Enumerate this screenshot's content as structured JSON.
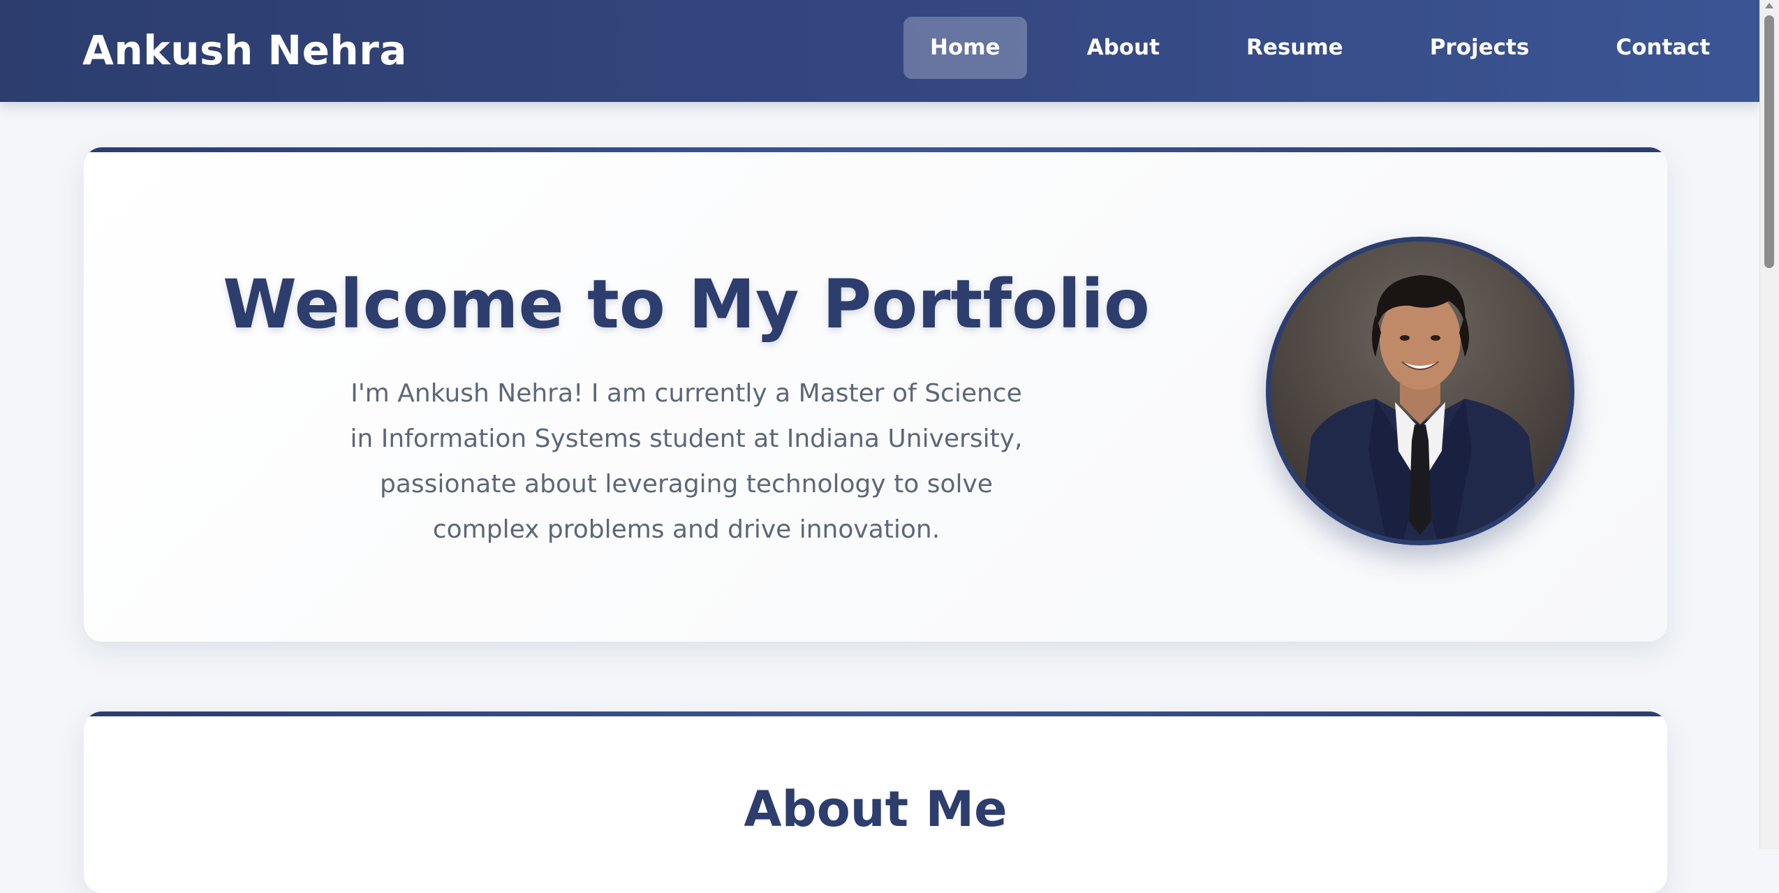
{
  "navbar": {
    "brand": "Ankush Nehra",
    "links": [
      {
        "label": "Home",
        "active": true
      },
      {
        "label": "About",
        "active": false
      },
      {
        "label": "Resume",
        "active": false
      },
      {
        "label": "Projects",
        "active": false
      },
      {
        "label": "Contact",
        "active": false
      }
    ]
  },
  "hero": {
    "title": "Welcome to My Portfolio",
    "text": "I'm Ankush Nehra! I am currently a Master of Science in Information Systems student at Indiana University, passionate about leveraging technology to solve complex problems and drive innovation."
  },
  "about": {
    "title": "About Me"
  },
  "colors": {
    "primary": "#2c3d6e",
    "nav_gradient_end": "#3b5594",
    "text_muted": "#5c6778",
    "background": "#f4f6f9"
  }
}
